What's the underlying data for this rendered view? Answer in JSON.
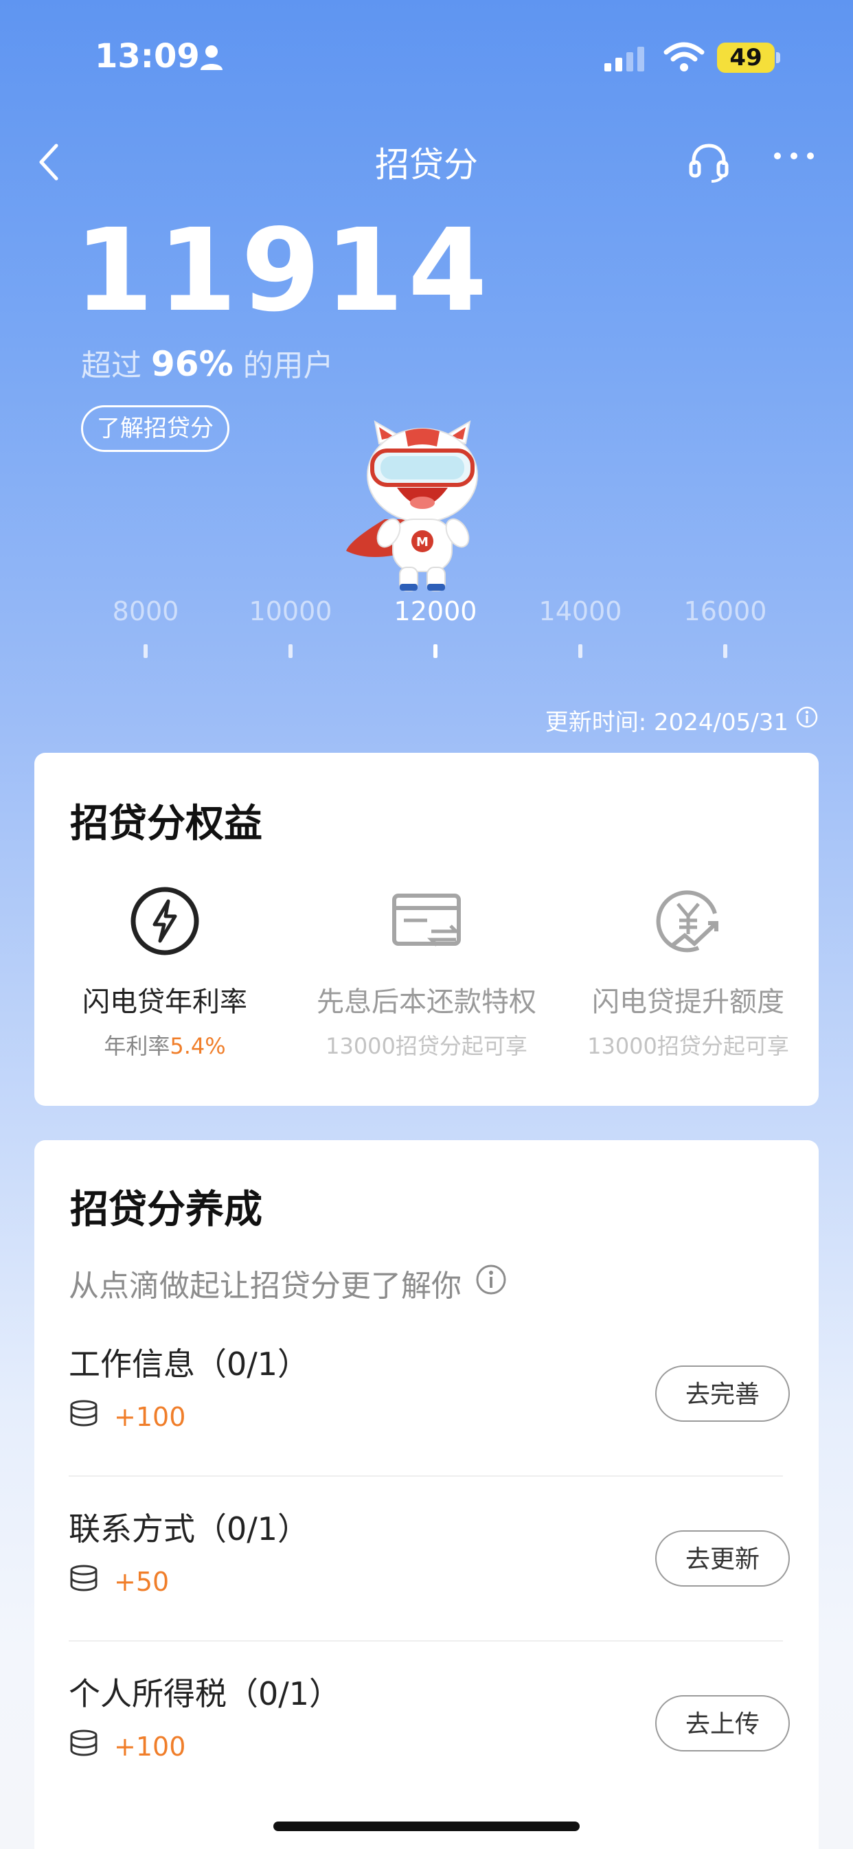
{
  "status": {
    "time": "13:09",
    "battery": "49"
  },
  "nav": {
    "title": "招贷分"
  },
  "hero": {
    "score": "11914",
    "percent_prefix": "超过",
    "percent_value": "96%",
    "percent_suffix": "的用户",
    "learn_label": "了解招贷分"
  },
  "scale": {
    "ticks": [
      "8000",
      "10000",
      "12000",
      "14000",
      "16000"
    ],
    "active": "12000"
  },
  "update_time": "更新时间: 2024/05/31",
  "benefits_card": {
    "title": "招贷分权益",
    "items": [
      {
        "title": "闪电贷年利率",
        "sub_prefix": "年利率",
        "sub_value": "5.4%",
        "icon": "lightning-icon"
      },
      {
        "title": "先息后本还款特权",
        "sub": "13000招贷分起可享",
        "icon": "card-swap-icon"
      },
      {
        "title": "闪电贷提升额度",
        "sub": "13000招贷分起可享",
        "icon": "yen-up-icon"
      }
    ]
  },
  "growth_card": {
    "title": "招贷分养成",
    "subtitle": "从点滴做起让招贷分更了解你",
    "tasks": [
      {
        "name": "工作信息（0/1）",
        "points": "+100",
        "button": "去完善"
      },
      {
        "name": "联系方式（0/1）",
        "points": "+50",
        "button": "去更新"
      },
      {
        "name": "个人所得税（0/1）",
        "points": "+100",
        "button": "去上传"
      }
    ]
  },
  "colors": {
    "accent_orange": "#f07e2a",
    "header_blue": "#5f95f1"
  }
}
